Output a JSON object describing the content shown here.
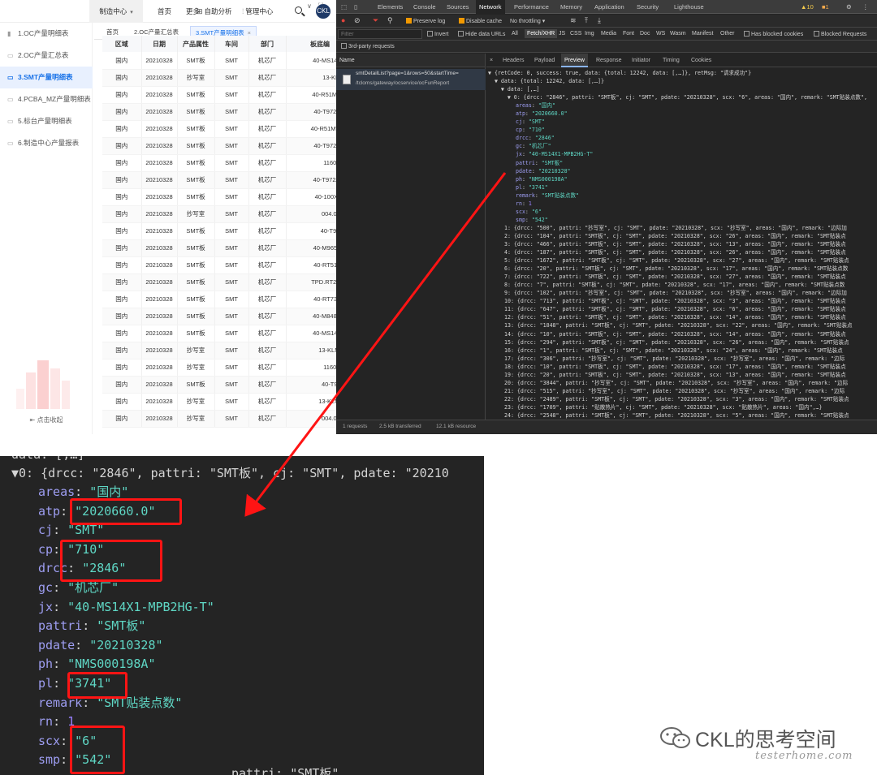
{
  "topnav": {
    "menu_label": "制造中心",
    "home": "首页",
    "more": "更多",
    "self_analysis": "自助分析",
    "mfg_center": "管理中心",
    "avatar_text": "CKL"
  },
  "sidebar": {
    "items": [
      {
        "label": "1.OC产量明细表"
      },
      {
        "label": "2.OC产量汇总表"
      },
      {
        "label": "3.SMT产量明细表"
      },
      {
        "label": "4.PCBA_MZ产量明细表"
      },
      {
        "label": "5.标台产量明细表"
      },
      {
        "label": "6.制造中心产量报表"
      }
    ],
    "collapse": "点击收起"
  },
  "tabs": {
    "home": "首页",
    "oc_summary": "2.OC产量汇总表",
    "smt_detail": "3.SMT产量明细表",
    "close": "×"
  },
  "table": {
    "headers": [
      "区域",
      "日期",
      "产品属性",
      "车间",
      "部门",
      "板底编"
    ],
    "rows": [
      [
        "国内",
        "20210328",
        "SMT板",
        "SMT",
        "机芯厂",
        "40-MS14X1-M"
      ],
      [
        "国内",
        "20210328",
        "抄写室",
        "SMT",
        "机芯厂",
        "13-KLM8G"
      ],
      [
        "国内",
        "20210328",
        "SMT板",
        "SMT",
        "机芯厂",
        "40-R51MH1-M"
      ],
      [
        "国内",
        "20210328",
        "SMT板",
        "SMT",
        "机芯厂",
        "40-T972AH-M"
      ],
      [
        "国内",
        "20210328",
        "SMT板",
        "SMT",
        "机芯厂",
        "40-R51MW1-M"
      ],
      [
        "国内",
        "20210328",
        "SMT板",
        "SMT",
        "机芯厂",
        "40-T972AN-M"
      ],
      [
        "国内",
        "20210328",
        "SMT板",
        "SMT",
        "机芯厂",
        "11602-500"
      ],
      [
        "国内",
        "20210328",
        "SMT板",
        "SMT",
        "机芯厂",
        "40-T972AM-M"
      ],
      [
        "国内",
        "20210328",
        "SMT板",
        "SMT",
        "机芯厂",
        "40-100X6R-D"
      ],
      [
        "国内",
        "20210328",
        "抄写室",
        "SMT",
        "机芯厂",
        "004.052.00"
      ],
      [
        "国内",
        "20210328",
        "SMT板",
        "SMT",
        "机芯厂",
        "40-T972AQ"
      ],
      [
        "国内",
        "20210328",
        "SMT板",
        "SMT",
        "机芯厂",
        "40-M9652C-M"
      ],
      [
        "国内",
        "20210328",
        "SMT板",
        "SMT",
        "机芯厂",
        "40-RT51H2-M"
      ],
      [
        "国内",
        "20210328",
        "SMT板",
        "SMT",
        "机芯厂",
        "TPD.RT2841.F"
      ],
      [
        "国内",
        "20210328",
        "SMT板",
        "SMT",
        "机芯厂",
        "40-RT73H2-M"
      ],
      [
        "国内",
        "20210328",
        "SMT板",
        "SMT",
        "机芯厂",
        "40-M848CV-M"
      ],
      [
        "国内",
        "20210328",
        "SMT板",
        "SMT",
        "机芯厂",
        "40-MS14FA-M"
      ],
      [
        "国内",
        "20210328",
        "抄写室",
        "SMT",
        "机芯厂",
        "13-KLMAG1"
      ],
      [
        "国内",
        "20210328",
        "抄写室",
        "SMT",
        "机芯厂",
        "11602-500"
      ],
      [
        "国内",
        "20210328",
        "SMT板",
        "SMT",
        "机芯厂",
        "40-T972AF"
      ],
      [
        "国内",
        "20210328",
        "抄写室",
        "SMT",
        "机芯厂",
        "13-KLMAG1"
      ],
      [
        "国内",
        "20210328",
        "抄写室",
        "SMT",
        "机芯厂",
        "004.052.00"
      ]
    ]
  },
  "devtools": {
    "tabs": [
      "Elements",
      "Console",
      "Sources",
      "Network",
      "Performance",
      "Memory",
      "Application",
      "Security",
      "Lighthouse"
    ],
    "warn_count": "10",
    "err_count": "1",
    "toolbar": {
      "preserve_log": "Preserve log",
      "disable_cache": "Disable cache",
      "throttling": "No throttling"
    },
    "filter": {
      "placeholder": "Filter",
      "invert": "Invert",
      "hide_data_urls": "Hide data URLs",
      "types": [
        "All",
        "Fetch/XHR",
        "JS",
        "CSS",
        "Img",
        "Media",
        "Font",
        "Doc",
        "WS",
        "Wasm",
        "Manifest",
        "Other"
      ],
      "blocked_cookies": "Has blocked cookies",
      "blocked_requests": "Blocked Requests"
    },
    "third_party": "3rd-party requests",
    "name_header": "Name",
    "request": {
      "line1": "smtDetailList?page=1&rows=50&startTime=",
      "line2": "/tcloms/gateway/ocservice/ocFunReport"
    },
    "detail_tabs": [
      "×",
      "Headers",
      "Payload",
      "Preview",
      "Response",
      "Initiator",
      "Timing",
      "Cookies"
    ],
    "status": {
      "requests": "1 requests",
      "transferred": "2.5 kB transferred",
      "resources": "12.1 kB resource"
    },
    "json_head": [
      "▼ {retCode: 0, success: true, data: {total: 12242, data: [,…]}, retMsg: \"请求成功\"}",
      "  ▼ data: {total: 12242, data: [,…]}",
      "    ▼ data: [,…]",
      "      ▼ 0: {drcc: \"2846\", pattri: \"SMT板\", cj: \"SMT\", pdate: \"20210328\", scx: \"6\", areas: \"国内\", remark: \"SMT贴装点数\","
    ],
    "json_fields": [
      {
        "k": "areas",
        "v": "\"国内\""
      },
      {
        "k": "atp",
        "v": "\"2020660.0\""
      },
      {
        "k": "cj",
        "v": "\"SMT\""
      },
      {
        "k": "cp",
        "v": "\"710\""
      },
      {
        "k": "drcc",
        "v": "\"2846\""
      },
      {
        "k": "gc",
        "v": "\"机芯厂\""
      },
      {
        "k": "jx",
        "v": "\"40-MS14X1-MPB2HG-T\""
      },
      {
        "k": "pattri",
        "v": "\"SMT板\""
      },
      {
        "k": "pdate",
        "v": "\"20210328\""
      },
      {
        "k": "ph",
        "v": "\"NMS000198A\""
      },
      {
        "k": "pl",
        "v": "\"3741\""
      },
      {
        "k": "remark",
        "v": "\"SMT贴装点数\""
      },
      {
        "k": "rn",
        "v": "1"
      },
      {
        "k": "scx",
        "v": "\"6\""
      },
      {
        "k": "smp",
        "v": "\"542\""
      }
    ],
    "json_rows": [
      "1: {drcc: \"500\", pattri: \"抄写室\", cj: \"SMT\", pdate: \"20210328\", scx: \"抄写室\", areas: \"国内\", remark: \"边际加",
      "2: {drcc: \"104\", pattri: \"SMT板\", cj: \"SMT\", pdate: \"20210328\", scx: \"26\", areas: \"国内\", remark: \"SMT贴装点",
      "3: {drcc: \"466\", pattri: \"SMT板\", cj: \"SMT\", pdate: \"20210328\", scx: \"13\", areas: \"国内\", remark: \"SMT贴装点",
      "4: {drcc: \"187\", pattri: \"SMT板\", cj: \"SMT\", pdate: \"20210328\", scx: \"26\", areas: \"国内\", remark: \"SMT贴装点",
      "5: {drcc: \"1672\", pattri: \"SMT板\", cj: \"SMT\", pdate: \"20210328\", scx: \"27\", areas: \"国内\", remark: \"SMT贴装点",
      "6: {drcc: \"20\", pattri: \"SMT板\", cj: \"SMT\", pdate: \"20210328\", scx: \"17\", areas: \"国内\", remark: \"SMT贴装点数",
      "7: {drcc: \"722\", pattri: \"SMT板\", cj: \"SMT\", pdate: \"20210328\", scx: \"27\", areas: \"国内\", remark: \"SMT贴装点",
      "8: {drcc: \"7\", pattri: \"SMT板\", cj: \"SMT\", pdate: \"20210328\", scx: \"17\", areas: \"国内\", remark: \"SMT贴装点数",
      "9: {drcc: \"102\", pattri: \"抄写室\", cj: \"SMT\", pdate: \"20210328\", scx: \"抄写室\", areas: \"国内\", remark: \"边际加",
      "10: {drcc: \"713\", pattri: \"SMT板\", cj: \"SMT\", pdate: \"20210328\", scx: \"3\", areas: \"国内\", remark: \"SMT贴装点",
      "11: {drcc: \"647\", pattri: \"SMT板\", cj: \"SMT\", pdate: \"20210328\", scx: \"6\", areas: \"国内\", remark: \"SMT贴装点",
      "12: {drcc: \"51\", pattri: \"SMT板\", cj: \"SMT\", pdate: \"20210328\", scx: \"14\", areas: \"国内\", remark: \"SMT贴装点",
      "13: {drcc: \"1848\", pattri: \"SMT板\", cj: \"SMT\", pdate: \"20210328\", scx: \"22\", areas: \"国内\", remark: \"SMT贴装点",
      "14: {drcc: \"10\", pattri: \"SMT板\", cj: \"SMT\", pdate: \"20210328\", scx: \"14\", areas: \"国内\", remark: \"SMT贴装点",
      "15: {drcc: \"294\", pattri: \"SMT板\", cj: \"SMT\", pdate: \"20210328\", scx: \"26\", areas: \"国内\", remark: \"SMT贴装点",
      "16: {drcc: \"1\", pattri: \"SMT板\", cj: \"SMT\", pdate: \"20210328\", scx: \"24\", areas: \"国内\", remark: \"SMT贴装点",
      "17: {drcc: \"306\", pattri: \"抄写室\", cj: \"SMT\", pdate: \"20210328\", scx: \"抄写室\", areas: \"国内\", remark: \"边际",
      "18: {drcc: \"10\", pattri: \"SMT板\", cj: \"SMT\", pdate: \"20210328\", scx: \"17\", areas: \"国内\", remark: \"SMT贴装点",
      "19: {drcc: \"20\", pattri: \"SMT板\", cj: \"SMT\", pdate: \"20210328\", scx: \"13\", areas: \"国内\", remark: \"SMT贴装点",
      "20: {drcc: \"3844\", pattri: \"抄写室\", cj: \"SMT\", pdate: \"20210328\", scx: \"抄写室\", areas: \"国内\", remark: \"边际",
      "21: {drcc: \"515\", pattri: \"抄写室\", cj: \"SMT\", pdate: \"20210328\", scx: \"抄写室\", areas: \"国内\", remark: \"边际",
      "22: {drcc: \"2489\", pattri: \"SMT板\", cj: \"SMT\", pdate: \"20210328\", scx: \"3\", areas: \"国内\", remark: \"SMT贴装点",
      "23: {drcc: \"1709\", pattri: \"贴散热片\", cj: \"SMT\", pdate: \"20210328\", scx: \"贴散热片\", areas: \"国内\",…}",
      "24: {drcc: \"2548\", pattri: \"SMT板\", cj: \"SMT\", pdate: \"20210328\", scx: \"5\", areas: \"国内\", remark: \"SMT贴装点",
      "25: {drcc: \"64\", pattri: \"SMT板\", cj: \"SMT\", pdate: \"20210328\", scx: \"14\", areas: \"国内\", remark: \"SMT贴装点"
    ]
  },
  "zoom": {
    "top_line": "data: [,…]",
    "head_line": "▼0: {drcc: \"2846\", pattri: \"SMT板\", cj: \"SMT\", pdate: \"20210",
    "fields": [
      {
        "k": "areas",
        "v": "\"国内\""
      },
      {
        "k": "atp",
        "v": "\"2020660.0\""
      },
      {
        "k": "cj",
        "v": "\"SMT\""
      },
      {
        "k": "cp",
        "v": "\"710\""
      },
      {
        "k": "drcc",
        "v": "\"2846\""
      },
      {
        "k": "gc",
        "v": "\"机芯厂\""
      },
      {
        "k": "jx",
        "v": "\"40-MS14X1-MPB2HG-T\""
      },
      {
        "k": "pattri",
        "v": "\"SMT板\""
      },
      {
        "k": "pdate",
        "v": "\"20210328\""
      },
      {
        "k": "ph",
        "v": "\"NMS000198A\""
      },
      {
        "k": "pl",
        "v": "\"3741\""
      },
      {
        "k": "remark",
        "v": "\"SMT贴装点数\""
      },
      {
        "k": "rn",
        "v": "1"
      },
      {
        "k": "scx",
        "v": "\"6\""
      },
      {
        "k": "smp",
        "v": "\"542\""
      }
    ],
    "bottom_line": "pattri: \"SMT板\""
  },
  "watermark": {
    "title": "CKL的思考空间",
    "subtitle": "testerhome.com"
  },
  "colors": {
    "accent": "#1a73e8",
    "highlight_red": "#ff1414",
    "devtools_bg": "#242424"
  }
}
